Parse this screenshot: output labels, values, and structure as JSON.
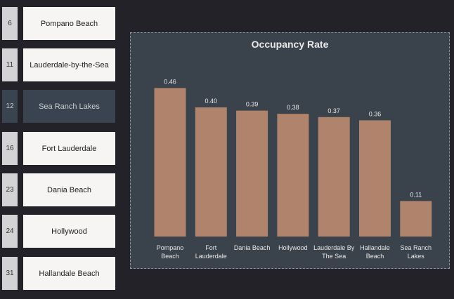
{
  "list": {
    "rows": [
      {
        "rank": "6",
        "name": "Pompano Beach",
        "selected": false
      },
      {
        "rank": "11",
        "name": "Lauderdale-by-the-Sea",
        "selected": false
      },
      {
        "rank": "12",
        "name": "Sea Ranch Lakes",
        "selected": true
      },
      {
        "rank": "16",
        "name": "Fort Lauderdale",
        "selected": false
      },
      {
        "rank": "23",
        "name": "Dania Beach",
        "selected": false
      },
      {
        "rank": "24",
        "name": "Hollywood",
        "selected": false
      },
      {
        "rank": "31",
        "name": "Hallandale Beach",
        "selected": false
      }
    ]
  },
  "chart_data": {
    "type": "bar",
    "title": "Occupancy Rate",
    "categories": [
      [
        "Pompano",
        "Beach"
      ],
      [
        "Fort",
        "Lauderdale"
      ],
      [
        "Dania Beach"
      ],
      [
        "Hollywood"
      ],
      [
        "Lauderdale By",
        "The Sea"
      ],
      [
        "Hallandale",
        "Beach"
      ],
      [
        "Sea Ranch",
        "Lakes"
      ]
    ],
    "values": [
      0.46,
      0.4,
      0.39,
      0.38,
      0.37,
      0.36,
      0.11
    ],
    "data_labels": [
      "0.46",
      "0.40",
      "0.39",
      "0.38",
      "0.37",
      "0.36",
      "0.11"
    ],
    "ylim": [
      0,
      0.5
    ],
    "grid": false,
    "colors": {
      "bar": "#b0846c",
      "plot_bg": "#3a424b",
      "text": "#e8e8e8"
    }
  }
}
